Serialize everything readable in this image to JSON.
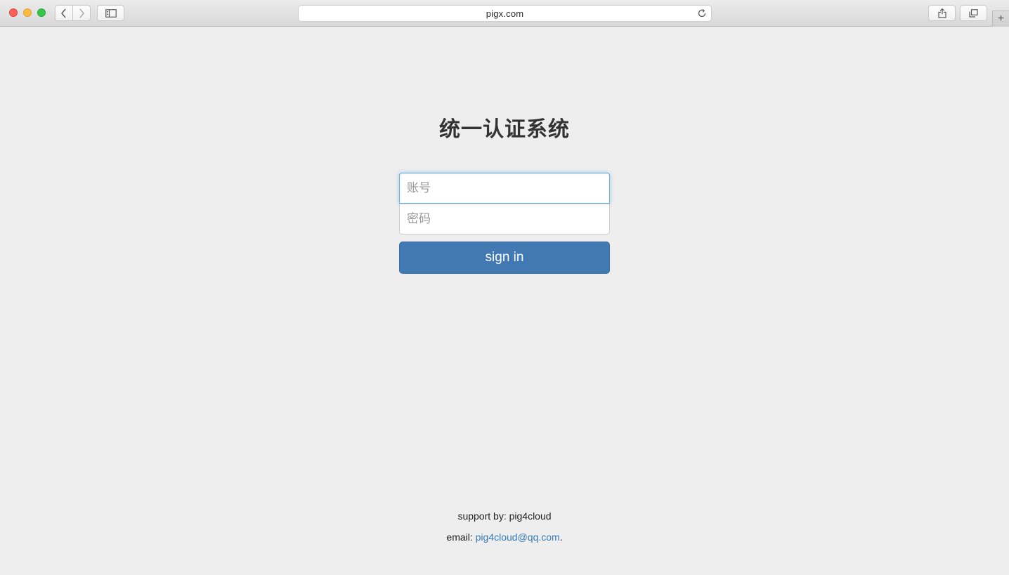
{
  "browser": {
    "url": "pigx.com",
    "new_tab_label": "+"
  },
  "page": {
    "title": "统一认证系统",
    "username_placeholder": "账号",
    "password_placeholder": "密码",
    "submit_label": "sign in",
    "support_text": "support by: pig4cloud",
    "email_prefix": "email: ",
    "email_address": "pig4cloud@qq.com",
    "email_suffix": "."
  },
  "colors": {
    "button_bg": "#4279b3",
    "link": "#337ab7",
    "page_bg": "#eeeeee"
  },
  "icons": [
    "back-icon",
    "forward-icon",
    "sidebar-icon",
    "reload-icon",
    "share-icon",
    "tabs-overview-icon"
  ]
}
